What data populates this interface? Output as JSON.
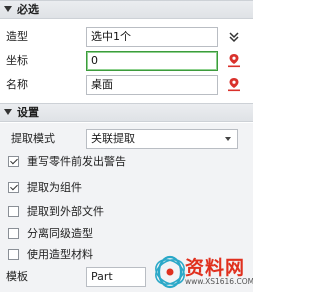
{
  "required_section": {
    "title": "必选",
    "rows": [
      {
        "label": "造型",
        "value": "选中1个"
      },
      {
        "label": "坐标",
        "value": "0"
      },
      {
        "label": "名称",
        "value": "桌面"
      }
    ]
  },
  "settings_section": {
    "title": "设置",
    "extract_mode": {
      "label": "提取模式",
      "value": "关联提取"
    },
    "options": [
      {
        "label": "重写零件前发出警告",
        "checked": true
      },
      {
        "label": "提取为组件",
        "checked": true
      },
      {
        "label": "提取到外部文件",
        "checked": false
      },
      {
        "label": "分离同级造型",
        "checked": false
      },
      {
        "label": "使用造型材料",
        "checked": false
      }
    ],
    "template": {
      "label": "模板",
      "value": "Part"
    }
  },
  "watermark": {
    "text": "资料网",
    "url": "www.XS1616.COM"
  },
  "colors": {
    "header_bg": "#e4e7eb",
    "active_border": "#3c9b3c",
    "pick_icon": "#d9312b",
    "watermark_red": "#e0301e",
    "watermark_teal": "#2aa8c8"
  },
  "icons": {
    "collapse": "chevron-double-down-icon",
    "pick": "pick-point-icon"
  }
}
